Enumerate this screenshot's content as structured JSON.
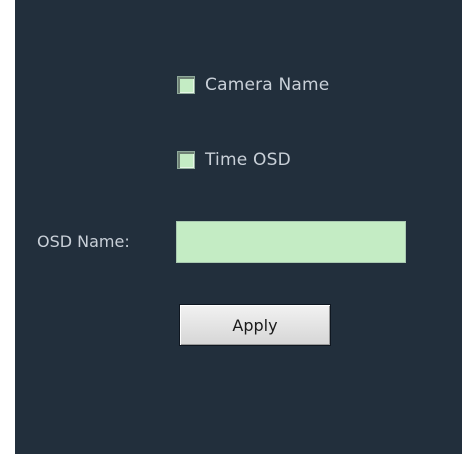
{
  "options": {
    "camera_name": {
      "label": "Camera Name",
      "checked": false
    },
    "time_osd": {
      "label": "Time OSD",
      "checked": false
    }
  },
  "osd_name": {
    "label": "OSD Name:",
    "value": ""
  },
  "apply_button": {
    "label": "Apply"
  },
  "colors": {
    "panel_background": "#222f3c",
    "field_fill": "#c4ecc4",
    "label_text": "#c9d0d8"
  }
}
